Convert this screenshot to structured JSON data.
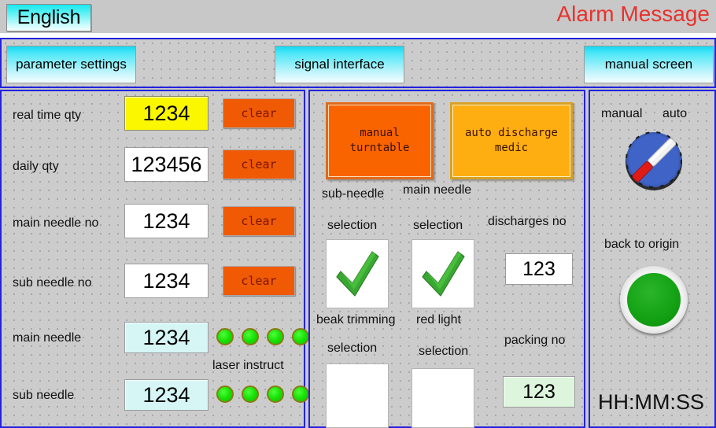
{
  "header": {
    "language_button": "English",
    "alarm_title": "Alarm Message"
  },
  "nav": {
    "parameter_settings": "parameter settings",
    "signal_interface": "signal interface",
    "manual_screen": "manual screen"
  },
  "left_panel": {
    "rows": [
      {
        "label": "real time qty",
        "value": "1234",
        "button": "clear"
      },
      {
        "label": "daily qty",
        "value": "123456",
        "button": "clear"
      },
      {
        "label": "main needle no",
        "value": "1234",
        "button": "clear"
      },
      {
        "label": "sub needle no",
        "value": "1234",
        "button": "clear"
      }
    ],
    "main_needle": {
      "label": "main needle",
      "value": "1234"
    },
    "sub_needle": {
      "label": "sub needle",
      "value": "1234"
    },
    "laser_instruct_label": "laser instruct",
    "led_count_main": 4,
    "led_count_sub": 4
  },
  "center_panel": {
    "turntable_button": "manual\nturntable",
    "discharge_button": "auto discharge\nmedic",
    "sub_needle_selection_label_1": "sub-needle",
    "sub_needle_selection_label_2": "selection",
    "main_needle_selection_label_1": "main needle",
    "main_needle_selection_label_2": "selection",
    "beak_trimming_label_1": "beak trimming",
    "beak_trimming_label_2": "selection",
    "red_light_label_1": "red light",
    "red_light_label_2": "selection",
    "discharges_no_label": "discharges no",
    "discharges_no_value": "123",
    "packing_no_label": "packing no",
    "packing_no_value": "123",
    "sub_needle_checked": true,
    "main_needle_checked": true,
    "beak_trimming_checked": false,
    "red_light_checked": false,
    "check_glyph": "check-icon"
  },
  "right_panel": {
    "mode_manual_label": "manual",
    "mode_auto_label": "auto",
    "selector_icon": "rotary-selector-icon",
    "back_to_origin_label": "back to origin",
    "back_to_origin_icon": "green-push-button-icon",
    "clock": "HH:MM:SS"
  },
  "colors": {
    "accent_blue_border": "#2222dd",
    "nav_cyan": "#17d9f2",
    "alarm_red": "#e8322d",
    "clear_orange": "#f05a05",
    "turntable_orange": "#fa6400",
    "discharge_amber": "#ffae12",
    "led_green": "#17e005",
    "field_yellow": "#fbf700",
    "field_cyan": "#d6f6f6",
    "field_green": "#ddf5dd",
    "panel_gray": "#cccccc"
  }
}
